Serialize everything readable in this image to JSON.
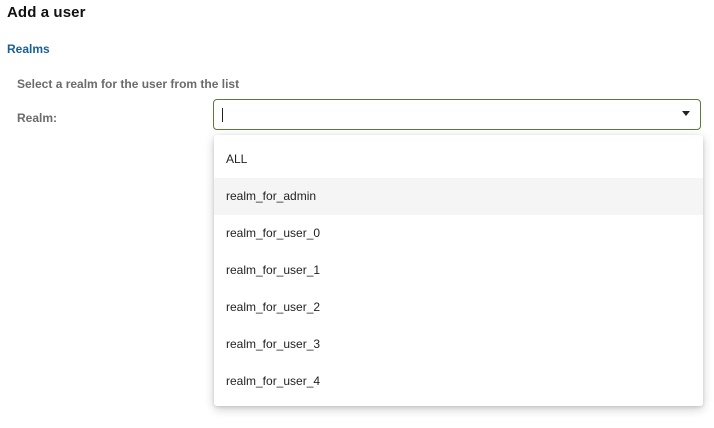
{
  "page": {
    "title": "Add a user"
  },
  "realms": {
    "section_title": "Realms",
    "hint": "Select a realm for the user from the list",
    "field_label": "Realm:",
    "select_value": "",
    "options": [
      "ALL",
      "realm_for_admin",
      "realm_for_user_0",
      "realm_for_user_1",
      "realm_for_user_2",
      "realm_for_user_3",
      "realm_for_user_4"
    ],
    "hovered_option": "realm_for_admin"
  },
  "colors": {
    "section_title": "#1a5e98",
    "select_border": "#5c7a3d",
    "hover_bg": "#f5f5f5"
  },
  "icons": {
    "dropdown_arrow": "chevron-down-icon"
  }
}
